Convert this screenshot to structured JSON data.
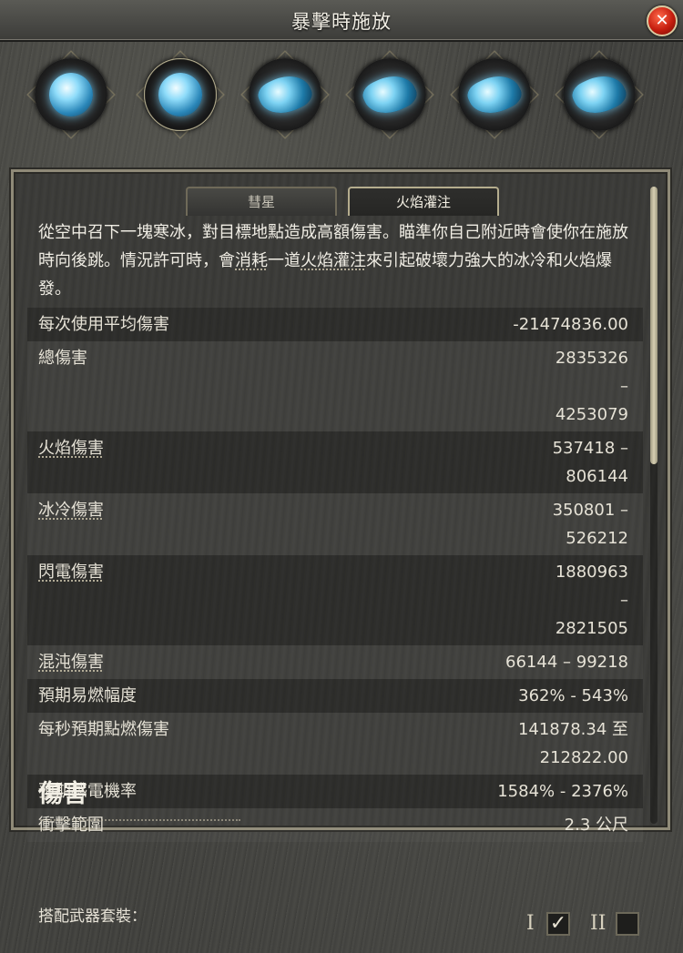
{
  "window": {
    "title": "暴擊時施放"
  },
  "gems": [
    {
      "icon": "ice-orb-gem-icon",
      "state": "normal"
    },
    {
      "icon": "frost-orb-gem-icon",
      "state": "selected"
    },
    {
      "icon": "ice-crystal-gem-icon",
      "state": "normal"
    },
    {
      "icon": "ice-crystal-gem-icon",
      "state": "normal"
    },
    {
      "icon": "ice-crystal-gem-icon",
      "state": "normal"
    },
    {
      "icon": "ice-crystal-gem-icon",
      "state": "normal"
    }
  ],
  "tabs": [
    {
      "label": "彗星",
      "active": false
    },
    {
      "label": "火焰灌注",
      "active": true
    }
  ],
  "description": {
    "part1": "從空中召下一塊寒冰，對目標地點造成高額傷害。瞄準你自己附近時會使你在施放時向後跳。情況許可時，會",
    "part2": "消耗",
    "part3": "一道",
    "part4": "火焰灌注",
    "part5": "來引起破壞力強大的冰冷和火焰爆發。"
  },
  "stats": [
    {
      "label": "每次使用平均傷害",
      "value": "-21474836.00"
    },
    {
      "label": "總傷害",
      "value": "2835326 – 4253079"
    },
    {
      "label": "火焰傷害",
      "value": "537418 – 806144"
    },
    {
      "label": "冰冷傷害",
      "value": "350801 – 526212"
    },
    {
      "label": "閃電傷害",
      "value": "1880963 – 2821505"
    },
    {
      "label": "混沌傷害",
      "value": "66144 – 99218"
    },
    {
      "label": "預期易燃幅度",
      "value": "362% - 543%"
    },
    {
      "label": "每秒預期點燃傷害",
      "value": "141878.34 至 212822.00"
    },
    {
      "label": "預期感電機率",
      "value": "1584% - 2376%"
    },
    {
      "label": "衝擊範圍",
      "value": "2.3 公尺"
    }
  ],
  "section_heading": "傷害",
  "footer": {
    "label": "搭配武器套裝：",
    "set1": "I",
    "set1_checked": "✓",
    "set2": "II"
  }
}
